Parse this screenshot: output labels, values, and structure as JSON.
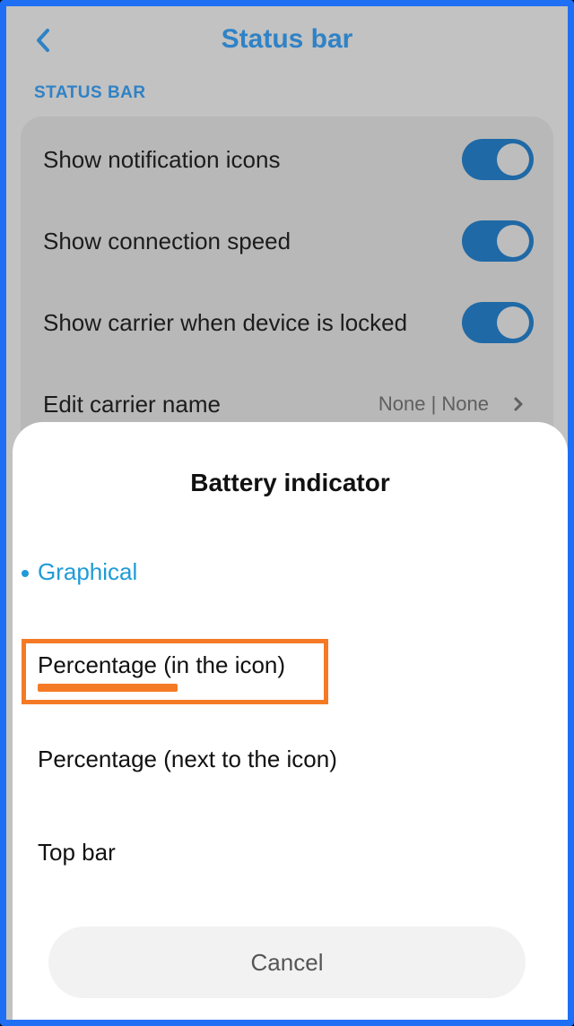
{
  "header": {
    "title": "Status bar",
    "back_icon": "chevron-left-icon"
  },
  "section": {
    "title": "STATUS BAR"
  },
  "settings": [
    {
      "label": "Show notification icons",
      "toggle": true
    },
    {
      "label": "Show connection speed",
      "toggle": true
    },
    {
      "label": "Show carrier when device is locked",
      "toggle": true
    },
    {
      "label": "Edit carrier name",
      "value": "None | None"
    }
  ],
  "dialog": {
    "title": "Battery indicator",
    "options": [
      {
        "label": "Graphical",
        "selected": true
      },
      {
        "label": "Percentage (in the icon)",
        "selected": false
      },
      {
        "label": "Percentage (next to the icon)",
        "selected": false
      },
      {
        "label": "Top bar",
        "selected": false
      }
    ],
    "cancel_label": "Cancel"
  },
  "colors": {
    "accent": "#1f9bd6",
    "header_blue": "#2f82c6",
    "highlight": "#f57a26",
    "frame": "#1f6ff5"
  }
}
